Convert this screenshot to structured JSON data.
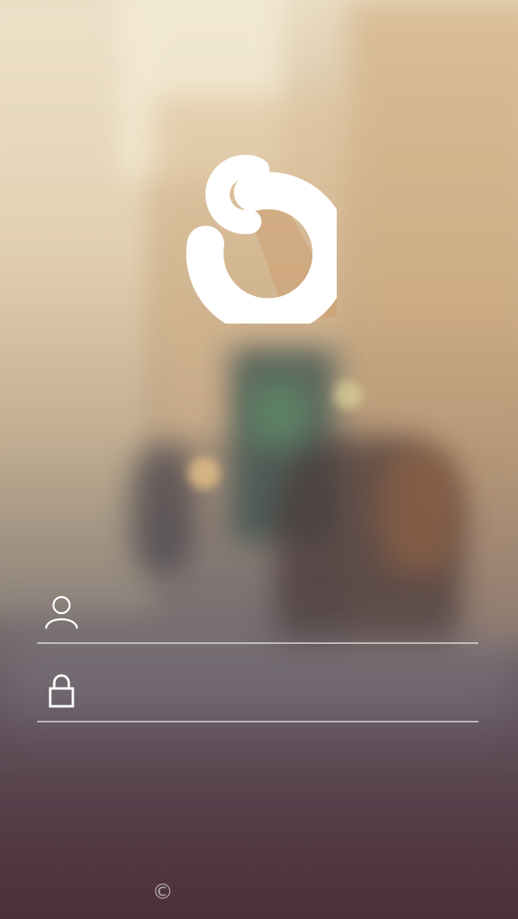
{
  "app": {
    "logo_icon": "swirl-s-logo"
  },
  "login": {
    "username": {
      "icon": "user-icon",
      "value": "",
      "placeholder": ""
    },
    "password": {
      "icon": "lock-icon",
      "value": "",
      "placeholder": ""
    }
  },
  "footer": {
    "copyright_symbol": "©"
  },
  "colors": {
    "logo": "#ffffff",
    "logo_shadow": "#c98e5c",
    "divider": "#ffffff"
  }
}
